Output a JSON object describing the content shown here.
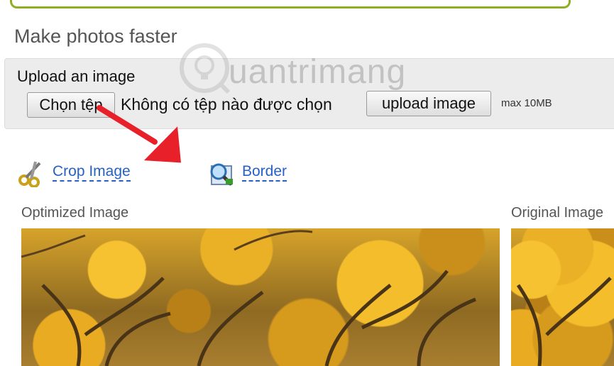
{
  "page": {
    "title": "Make photos faster"
  },
  "upload": {
    "label": "Upload an image",
    "choose_button": "Chọn tệp",
    "no_file_text": "Không có tệp nào được chọn",
    "upload_button": "upload image",
    "max_size": "max 10MB"
  },
  "tools": {
    "crop_label": "Crop Image",
    "border_label": "Border"
  },
  "sections": {
    "optimized_label": "Optimized Image",
    "original_label": "Original Image"
  },
  "watermark": {
    "text": "uantrimang"
  },
  "colors": {
    "accent_bar": "#8fae24",
    "link": "#2761c8",
    "arrow": "#e8202a"
  },
  "icons": {
    "crop": "scissors-icon",
    "border": "magnifier-icon"
  }
}
